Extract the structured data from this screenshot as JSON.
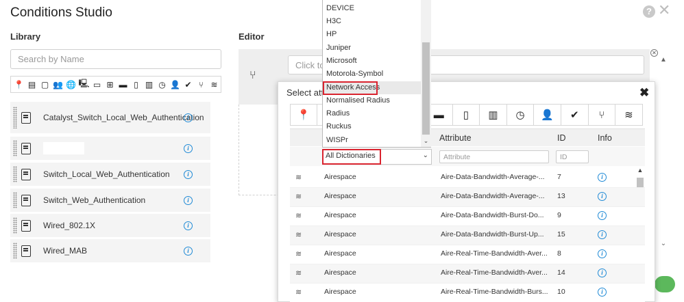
{
  "header": {
    "title": "Conditions Studio",
    "help_glyph": "?",
    "close_glyph": "✕"
  },
  "library": {
    "label": "Library",
    "search_placeholder": "Search by Name",
    "filter_icons": [
      "map-pin-icon",
      "dictionary-icon",
      "square-icon",
      "group-icon",
      "globe-icon",
      "monitor-icon",
      "screen-icon",
      "network-icon",
      "card-icon",
      "file-icon",
      "device-icon",
      "clock-icon",
      "user-icon",
      "check-circle-icon",
      "condition-tree-icon",
      "wifi-icon"
    ],
    "items": [
      {
        "label": "Catalyst_Switch_Local_Web_Authentication"
      },
      {
        "label": ""
      },
      {
        "label": "Switch_Local_Web_Authentication"
      },
      {
        "label": "Switch_Web_Authentication"
      },
      {
        "label": "Wired_802.1X"
      },
      {
        "label": "Wired_MAB"
      }
    ]
  },
  "editor": {
    "label": "Editor",
    "input_placeholder": "Click to add an attribute"
  },
  "modal": {
    "title": "Select attribute for condition",
    "close_glyph": "✖",
    "icon_tabs": [
      "map-pin-icon",
      "dictionary-icon",
      "square-icon",
      "group-icon",
      "globe-icon",
      "monitor-icon",
      "screen-icon",
      "network-icon",
      "card-icon",
      "file-icon",
      "device-icon",
      "clock-icon",
      "user-icon",
      "check-circle-icon",
      "condition-tree-icon",
      "wifi-icon"
    ],
    "columns": {
      "attribute": "Attribute",
      "id": "ID",
      "info": "Info"
    },
    "filters": {
      "dictionary_value": "All Dictionaries",
      "attribute_placeholder": "Attribute",
      "id_placeholder": "ID"
    },
    "rows": [
      {
        "dictionary": "Airespace",
        "attribute": "Aire-Data-Bandwidth-Average-...",
        "id": "7"
      },
      {
        "dictionary": "Airespace",
        "attribute": "Aire-Data-Bandwidth-Average-...",
        "id": "13"
      },
      {
        "dictionary": "Airespace",
        "attribute": "Aire-Data-Bandwidth-Burst-Do...",
        "id": "9"
      },
      {
        "dictionary": "Airespace",
        "attribute": "Aire-Data-Bandwidth-Burst-Up...",
        "id": "15"
      },
      {
        "dictionary": "Airespace",
        "attribute": "Aire-Real-Time-Bandwidth-Aver...",
        "id": "8"
      },
      {
        "dictionary": "Airespace",
        "attribute": "Aire-Real-Time-Bandwidth-Aver...",
        "id": "14"
      },
      {
        "dictionary": "Airespace",
        "attribute": "Aire-Real-Time-Bandwidth-Burs...",
        "id": "10"
      }
    ]
  },
  "dropdown": {
    "options": [
      "DEVICE",
      "H3C",
      "HP",
      "Juniper",
      "Microsoft",
      "Motorola-Symbol",
      "Network Access",
      "Normalised Radius",
      "Radius",
      "Ruckus",
      "WISPr"
    ],
    "highlighted": "Network Access"
  }
}
